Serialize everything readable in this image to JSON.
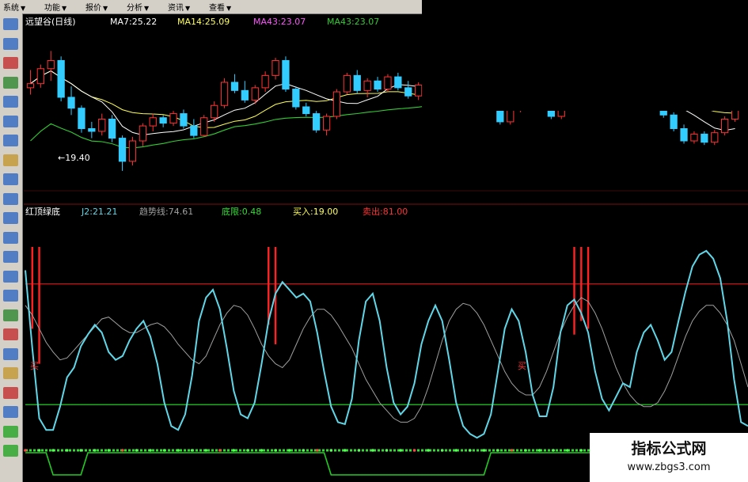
{
  "menu": [
    {
      "label": "系统",
      "arrow": "▼"
    },
    {
      "label": "功能",
      "arrow": "▼"
    },
    {
      "label": "报价",
      "arrow": "▼"
    },
    {
      "label": "分析",
      "arrow": "▼"
    },
    {
      "label": "资讯",
      "arrow": "▼"
    },
    {
      "label": "查看",
      "arrow": "▼"
    }
  ],
  "toolbar_icons": [
    {
      "name": "grid-icon",
      "color": "#3a6fc4"
    },
    {
      "name": "table-icon",
      "color": "#3a6fc4"
    },
    {
      "name": "line-chart-icon",
      "color": "#c43a3a"
    },
    {
      "name": "candle-icon",
      "color": "#3a8c3a"
    },
    {
      "name": "bar-icon",
      "color": "#3a6fc4"
    },
    {
      "name": "list-icon",
      "color": "#3a6fc4"
    },
    {
      "name": "window-icon",
      "color": "#3a6fc4"
    },
    {
      "name": "book-icon",
      "color": "#c49a3a"
    },
    {
      "name": "folder-icon",
      "color": "#3a6fc4"
    },
    {
      "name": "f10-icon",
      "color": "#3a6fc4"
    },
    {
      "name": "edit-icon",
      "color": "#3a6fc4"
    },
    {
      "name": "monitor-icon",
      "color": "#3a6fc4"
    },
    {
      "name": "database-icon",
      "color": "#3a6fc4"
    },
    {
      "name": "calc-icon",
      "color": "#3a6fc4"
    },
    {
      "name": "window2-icon",
      "color": "#3a6fc4"
    },
    {
      "name": "swap-icon",
      "color": "#3a8c3a"
    },
    {
      "name": "dollar-icon",
      "color": "#c43a3a"
    },
    {
      "name": "link-icon",
      "color": "#3a6fc4"
    },
    {
      "name": "pencil-icon",
      "color": "#c49a3a"
    },
    {
      "name": "bolt-icon",
      "color": "#c43a3a"
    },
    {
      "name": "cross-arrows-icon",
      "color": "#3a6fc4"
    },
    {
      "name": "up-arrow-icon",
      "color": "#2ea82e"
    },
    {
      "name": "down-arrow-icon",
      "color": "#2ea82e"
    }
  ],
  "chart_data": [
    {
      "type": "candlestick",
      "title": "远望谷(日线)",
      "indicators": [
        {
          "name": "MA7",
          "label": "MA7:25.22",
          "color": "#ffffff"
        },
        {
          "name": "MA14",
          "label": "MA14:25.09",
          "color": "#ffff55"
        },
        {
          "name": "MA43",
          "label": "MA43:23.07",
          "color": "#ff55ff"
        },
        {
          "name": "MA43",
          "label": "MA43:23.07",
          "color": "#33cc33"
        }
      ],
      "annotation": "←19.40",
      "up_color": "#ff3333",
      "down_color": "#33ccff",
      "candles": [
        [
          25.5,
          26.8,
          25.0,
          25.8
        ],
        [
          25.8,
          27.2,
          25.5,
          26.9
        ],
        [
          26.9,
          28.2,
          26.0,
          27.5
        ],
        [
          27.5,
          27.8,
          24.5,
          24.8
        ],
        [
          24.8,
          25.6,
          23.5,
          24.0
        ],
        [
          24.0,
          24.2,
          22.2,
          22.5
        ],
        [
          22.5,
          23.0,
          21.8,
          22.3
        ],
        [
          22.3,
          23.6,
          22.0,
          23.2
        ],
        [
          23.2,
          23.5,
          21.5,
          21.8
        ],
        [
          21.8,
          22.0,
          19.4,
          20.1
        ],
        [
          20.1,
          21.9,
          19.8,
          21.6
        ],
        [
          21.6,
          22.9,
          21.2,
          22.7
        ],
        [
          22.7,
          23.6,
          22.3,
          23.3
        ],
        [
          23.3,
          23.5,
          22.6,
          22.9
        ],
        [
          22.9,
          23.8,
          22.7,
          23.6
        ],
        [
          23.6,
          23.9,
          22.5,
          22.7
        ],
        [
          22.7,
          23.2,
          21.8,
          22.0
        ],
        [
          22.0,
          23.5,
          21.9,
          23.3
        ],
        [
          23.3,
          24.5,
          23.0,
          24.2
        ],
        [
          24.2,
          26.2,
          24.0,
          25.9
        ],
        [
          25.9,
          26.5,
          25.1,
          25.3
        ],
        [
          25.3,
          26.0,
          24.4,
          24.6
        ],
        [
          24.6,
          25.7,
          24.3,
          25.5
        ],
        [
          25.5,
          26.7,
          25.2,
          26.4
        ],
        [
          26.4,
          27.7,
          26.1,
          27.5
        ],
        [
          27.5,
          27.8,
          25.2,
          25.4
        ],
        [
          25.4,
          25.6,
          23.9,
          24.1
        ],
        [
          24.1,
          24.4,
          23.4,
          23.6
        ],
        [
          23.6,
          23.8,
          22.2,
          22.4
        ],
        [
          22.4,
          23.6,
          22.0,
          23.4
        ],
        [
          23.4,
          25.4,
          23.2,
          25.2
        ],
        [
          25.2,
          26.6,
          25.0,
          26.4
        ],
        [
          26.4,
          26.8,
          25.1,
          25.3
        ],
        [
          25.3,
          26.2,
          24.8,
          26.0
        ],
        [
          26.0,
          26.3,
          25.2,
          25.4
        ],
        [
          25.4,
          26.5,
          25.2,
          26.3
        ],
        [
          26.3,
          26.6,
          25.3,
          25.5
        ],
        [
          25.5,
          26.0,
          24.7,
          24.9
        ],
        [
          24.9,
          25.9,
          24.6,
          25.7
        ],
        [
          25.7,
          27.0,
          25.5,
          26.8
        ],
        [
          26.8,
          27.6,
          26.5,
          27.4
        ],
        [
          27.4,
          27.7,
          26.3,
          26.5
        ],
        [
          26.5,
          27.5,
          26.3,
          27.3
        ],
        [
          27.3,
          28.9,
          27.0,
          27.1
        ],
        [
          27.1,
          27.3,
          25.8,
          26.0
        ],
        [
          26.0,
          26.2,
          24.0,
          24.2
        ],
        [
          24.2,
          24.5,
          22.8,
          23.0
        ],
        [
          23.0,
          24.2,
          22.8,
          24.0
        ],
        [
          24.0,
          24.8,
          23.7,
          24.6
        ],
        [
          24.6,
          25.2,
          24.3,
          24.9
        ],
        [
          24.9,
          25.1,
          24.0,
          24.2
        ],
        [
          24.2,
          24.4,
          23.2,
          23.4
        ],
        [
          23.4,
          24.4,
          23.2,
          24.2
        ],
        [
          24.2,
          25.2,
          24.0,
          25.0
        ],
        [
          25.0,
          25.3,
          24.3,
          24.5
        ],
        [
          24.5,
          25.1,
          24.2,
          24.9
        ],
        [
          24.9,
          25.4,
          24.6,
          25.2
        ],
        [
          25.2,
          25.5,
          24.7,
          24.9
        ],
        [
          24.9,
          25.3,
          24.5,
          25.1
        ],
        [
          25.1,
          25.3,
          24.7,
          24.9
        ],
        [
          24.9,
          25.6,
          24.6,
          25.4
        ],
        [
          25.4,
          25.6,
          24.2,
          24.4
        ],
        [
          24.4,
          24.6,
          23.3,
          23.5
        ],
        [
          23.5,
          23.7,
          22.3,
          22.5
        ],
        [
          22.5,
          22.8,
          21.4,
          21.6
        ],
        [
          21.6,
          22.3,
          21.4,
          22.1
        ],
        [
          22.1,
          22.3,
          21.3,
          21.5
        ],
        [
          21.5,
          22.4,
          21.3,
          22.2
        ],
        [
          22.2,
          23.4,
          22.0,
          23.2
        ],
        [
          23.2,
          24.6,
          23.0,
          24.4
        ]
      ]
    },
    {
      "type": "line",
      "title": "红顶绿底",
      "legend": [
        {
          "name": "J2",
          "label": "J2:21.21",
          "color": "#5fd7e8"
        },
        {
          "name": "趋势线",
          "label": "趋势线:74.61",
          "color": "#a0a0a0"
        },
        {
          "name": "底限",
          "label": "底限:0.48",
          "color": "#33dd33"
        },
        {
          "name": "买入",
          "label": "买入:19.00",
          "color": "#ffff55"
        },
        {
          "name": "卖出",
          "label": "卖出:81.00",
          "color": "#ff3333"
        }
      ],
      "ylim": [
        0,
        100
      ],
      "levels": {
        "sell": 81,
        "buy": 19
      },
      "markers": [
        {
          "label": "买",
          "index": 1
        },
        {
          "label": "买",
          "index": 80
        }
      ],
      "j2": [
        88,
        48,
        12,
        6,
        6,
        18,
        33,
        38,
        49,
        55,
        60,
        56,
        46,
        42,
        44,
        52,
        58,
        62,
        54,
        40,
        20,
        8,
        6,
        14,
        34,
        62,
        74,
        78,
        68,
        48,
        26,
        14,
        12,
        20,
        40,
        62,
        76,
        82,
        78,
        74,
        76,
        72,
        56,
        36,
        18,
        10,
        9,
        22,
        52,
        72,
        76,
        62,
        38,
        20,
        14,
        18,
        30,
        50,
        62,
        70,
        62,
        42,
        20,
        8,
        4,
        2,
        4,
        14,
        36,
        58,
        68,
        62,
        46,
        24,
        13,
        13,
        28,
        56,
        70,
        73,
        66,
        56,
        36,
        22,
        16,
        23,
        30,
        28,
        46,
        56,
        60,
        52,
        42,
        46,
        62,
        77,
        90,
        96,
        98,
        94,
        84,
        62,
        32,
        10,
        8
      ],
      "trend": [
        70,
        65,
        58,
        51,
        46,
        42,
        43,
        47,
        51,
        55,
        59,
        63,
        64,
        61,
        58,
        56,
        56,
        58,
        60,
        61,
        59,
        55,
        50,
        46,
        42,
        40,
        44,
        52,
        60,
        66,
        70,
        69,
        65,
        58,
        50,
        44,
        40,
        38,
        42,
        50,
        58,
        64,
        68,
        68,
        65,
        60,
        54,
        48,
        40,
        32,
        26,
        20,
        16,
        12,
        10,
        10,
        12,
        18,
        28,
        40,
        52,
        62,
        68,
        71,
        70,
        66,
        60,
        52,
        44,
        36,
        30,
        26,
        24,
        24,
        28,
        36,
        46,
        56,
        64,
        70,
        74,
        72,
        66,
        58,
        48,
        38,
        30,
        24,
        20,
        18,
        18,
        20,
        26,
        34,
        44,
        54,
        62,
        67,
        70,
        70,
        66,
        60,
        52,
        40,
        28
      ],
      "spikes": [
        {
          "index": 1,
          "top": 100,
          "bottom": 58
        },
        {
          "index": 2,
          "top": 100,
          "bottom": 40
        },
        {
          "index": 35,
          "top": 100,
          "bottom": 60
        },
        {
          "index": 36,
          "top": 100,
          "bottom": 50
        },
        {
          "index": 79,
          "top": 100,
          "bottom": 55
        },
        {
          "index": 80,
          "top": 100,
          "bottom": 62
        },
        {
          "index": 81,
          "top": 100,
          "bottom": 58
        }
      ],
      "bottom_signal": [
        1,
        1,
        1,
        1,
        0,
        0,
        0,
        0,
        0,
        1,
        1,
        1,
        1,
        1,
        1,
        1,
        1,
        1,
        1,
        1,
        1,
        1,
        1,
        1,
        1,
        1,
        1,
        1,
        1,
        1,
        1,
        1,
        1,
        1,
        1,
        1,
        1,
        1,
        1,
        1,
        1,
        1,
        1,
        1,
        0,
        0,
        0,
        0,
        0,
        0,
        0,
        0,
        0,
        0,
        0,
        0,
        0,
        0,
        0,
        0,
        0,
        0,
        0,
        0,
        0,
        0,
        0,
        1,
        1,
        1,
        1,
        1,
        1,
        1,
        1,
        1,
        1,
        1,
        1,
        1,
        1,
        1,
        1,
        1,
        0,
        0,
        0,
        0,
        0,
        1,
        1,
        1,
        1,
        1,
        1,
        1,
        1,
        1,
        1,
        1,
        1,
        1,
        1,
        1,
        1
      ]
    }
  ],
  "watermark": {
    "title": "指标公式网",
    "url": "www.zbgs3.com"
  }
}
